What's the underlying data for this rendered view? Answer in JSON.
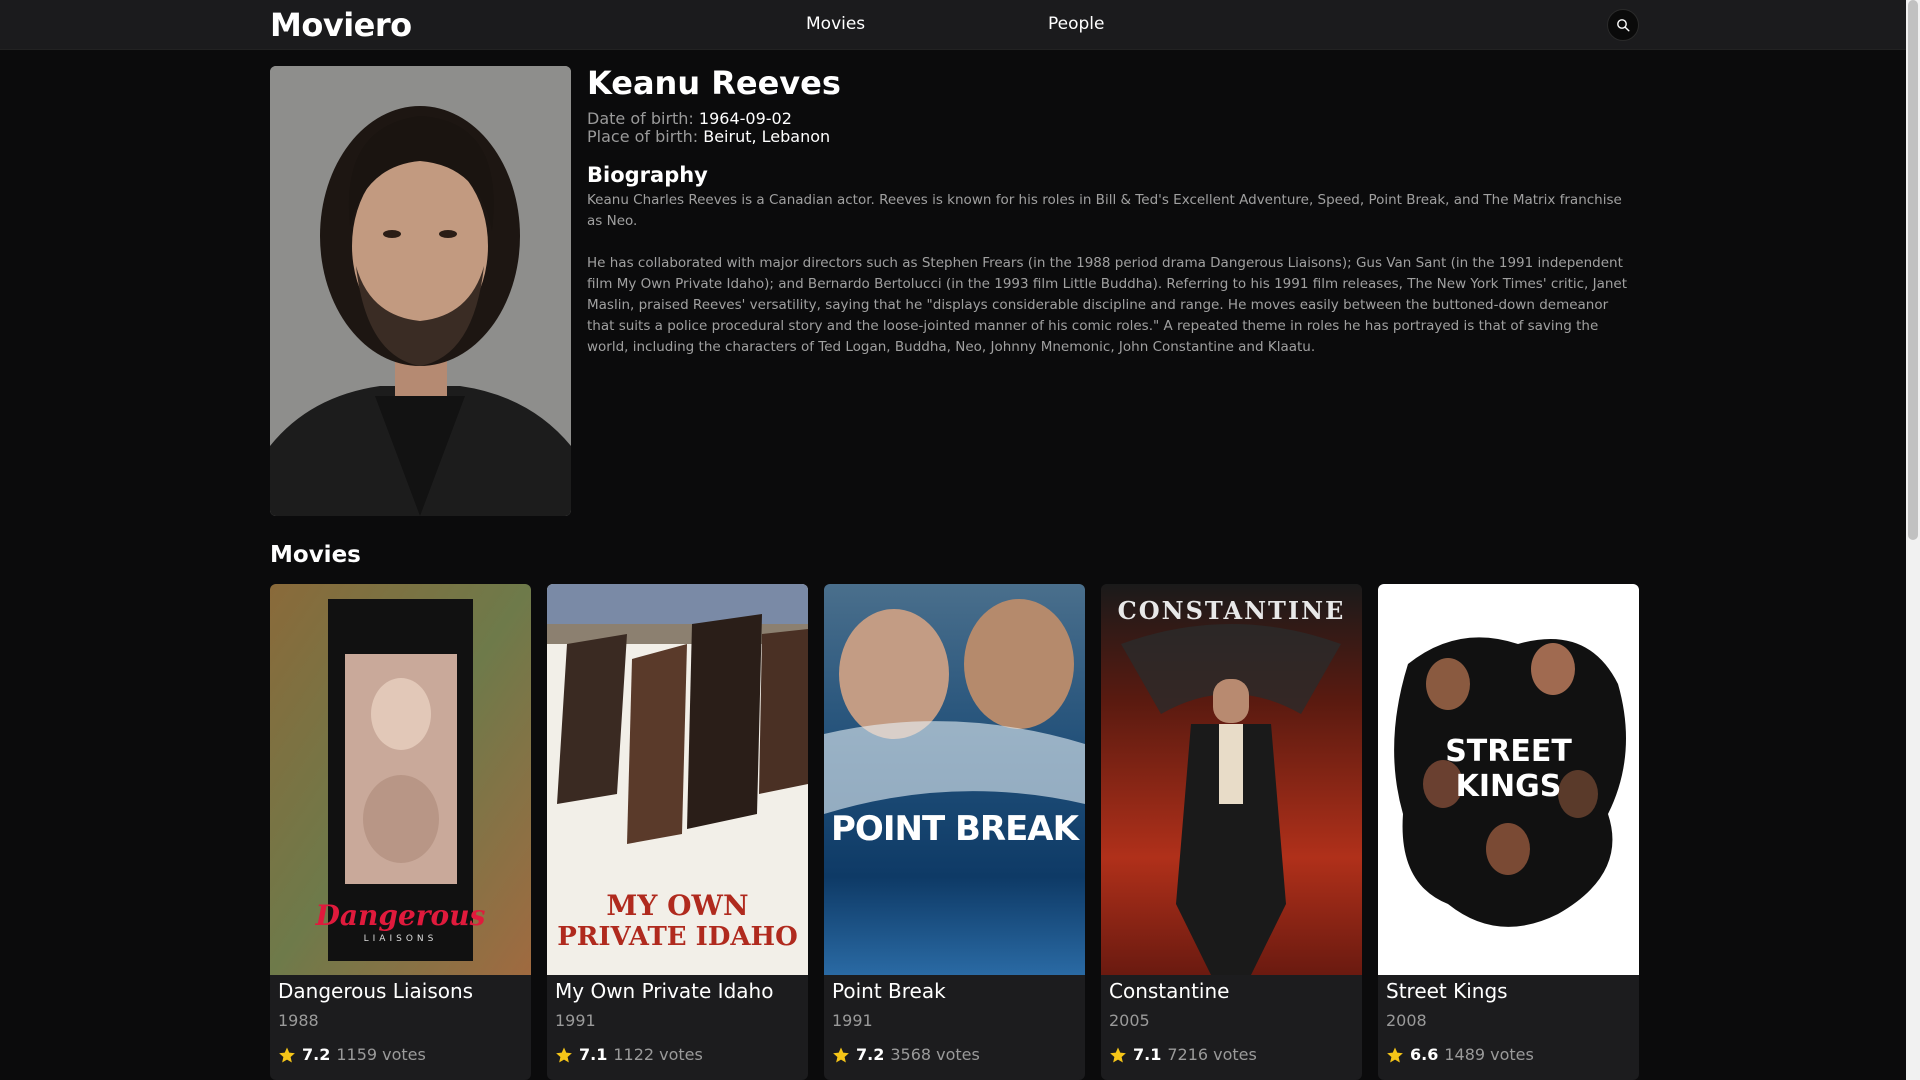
{
  "header": {
    "logo": "Moviero",
    "nav": [
      {
        "label": "Movies"
      },
      {
        "label": "People"
      }
    ],
    "search_icon": "search-icon"
  },
  "person": {
    "name": "Keanu Reeves",
    "dob_label": "Date of birth:",
    "dob_value": "1964-09-02",
    "pob_label": "Place of birth:",
    "pob_value": "Beirut, Lebanon",
    "bio_heading": "Biography",
    "bio_paragraphs": [
      "Keanu Charles Reeves is a Canadian actor. Reeves is known for his roles in Bill & Ted's Excellent Adventure, Speed, Point Break, and The Matrix franchise as Neo.",
      "He has collaborated with major directors such as Stephen Frears (in the 1988 period drama Dangerous Liaisons); Gus Van Sant (in the 1991 independent film My Own Private Idaho); and Bernardo Bertolucci (in the 1993 film Little Buddha). Referring to his 1991 film releases, The New York Times' critic, Janet Maslin, praised Reeves' versatility, saying that he \"displays considerable discipline and range. He moves easily between the buttoned-down demeanor that suits a police procedural story and the loose-jointed manner of his comic roles.\" A repeated theme in roles he has portrayed is that of saving the world, including the characters of Ted Logan, Buddha, Neo, Johnny Mnemonic, John Constantine and Klaatu."
    ]
  },
  "movies_section": {
    "title": "Movies",
    "items": [
      {
        "title": "Dangerous Liaisons",
        "year": "1988",
        "rating": "7.2",
        "votes": "1159 votes",
        "poster_text": "Dangerous",
        "poster_subtext": "LIAISONS"
      },
      {
        "title": "My Own Private Idaho",
        "year": "1991",
        "rating": "7.1",
        "votes": "1122 votes",
        "poster_text": "MY OWN",
        "poster_subtext": "PRIVATE IDAHO"
      },
      {
        "title": "Point Break",
        "year": "1991",
        "rating": "7.2",
        "votes": "3568 votes",
        "poster_text": "POINT BREAK"
      },
      {
        "title": "Constantine",
        "year": "2005",
        "rating": "7.1",
        "votes": "7216 votes",
        "poster_text": "CONSTANTINE"
      },
      {
        "title": "Street Kings",
        "year": "2008",
        "rating": "6.6",
        "votes": "1489 votes",
        "poster_text": "STREET",
        "poster_subtext": "KINGS"
      }
    ]
  },
  "colors": {
    "background": "#0b0b0c",
    "header": "#1b1b1d",
    "card": "#1c1c1e",
    "muted_text": "#9a9a9a",
    "star": "#f5c518"
  }
}
